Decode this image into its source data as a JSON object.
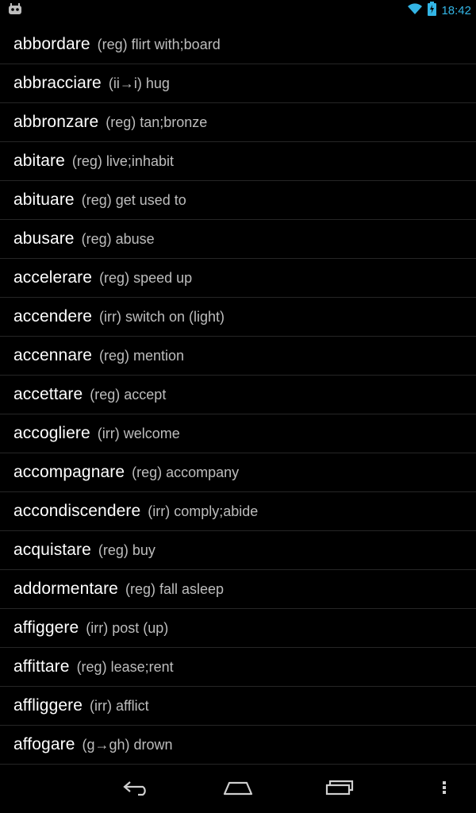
{
  "status": {
    "left_icon": "android-debug-icon",
    "wifi_icon": "wifi-icon",
    "battery_icon": "battery-charging-icon",
    "time": "18:42",
    "accent_color": "#33b5e5"
  },
  "verbs": [
    {
      "verb": "abbordare",
      "meta": "(reg) flirt with;board"
    },
    {
      "verb": "abbracciare",
      "meta": "(ii→i) hug"
    },
    {
      "verb": "abbronzare",
      "meta": "(reg) tan;bronze"
    },
    {
      "verb": "abitare",
      "meta": "(reg) live;inhabit"
    },
    {
      "verb": "abituare",
      "meta": "(reg) get used to"
    },
    {
      "verb": "abusare",
      "meta": "(reg) abuse"
    },
    {
      "verb": "accelerare",
      "meta": "(reg) speed up"
    },
    {
      "verb": "accendere",
      "meta": "(irr) switch on (light)"
    },
    {
      "verb": "accennare",
      "meta": "(reg) mention"
    },
    {
      "verb": "accettare",
      "meta": "(reg) accept"
    },
    {
      "verb": "accogliere",
      "meta": "(irr) welcome"
    },
    {
      "verb": "accompagnare",
      "meta": "(reg) accompany"
    },
    {
      "verb": "accondiscendere",
      "meta": "(irr) comply;abide"
    },
    {
      "verb": "acquistare",
      "meta": "(reg) buy"
    },
    {
      "verb": "addormentare",
      "meta": "(reg) fall asleep"
    },
    {
      "verb": "affiggere",
      "meta": "(irr) post (up)"
    },
    {
      "verb": "affittare",
      "meta": "(reg) lease;rent"
    },
    {
      "verb": "affliggere",
      "meta": "(irr) afflict"
    },
    {
      "verb": "affogare",
      "meta": "(g→gh) drown"
    }
  ],
  "nav": {
    "back_icon": "back-icon",
    "home_icon": "home-icon",
    "recents_icon": "recent-apps-icon",
    "menu_icon": "overflow-menu-icon"
  }
}
